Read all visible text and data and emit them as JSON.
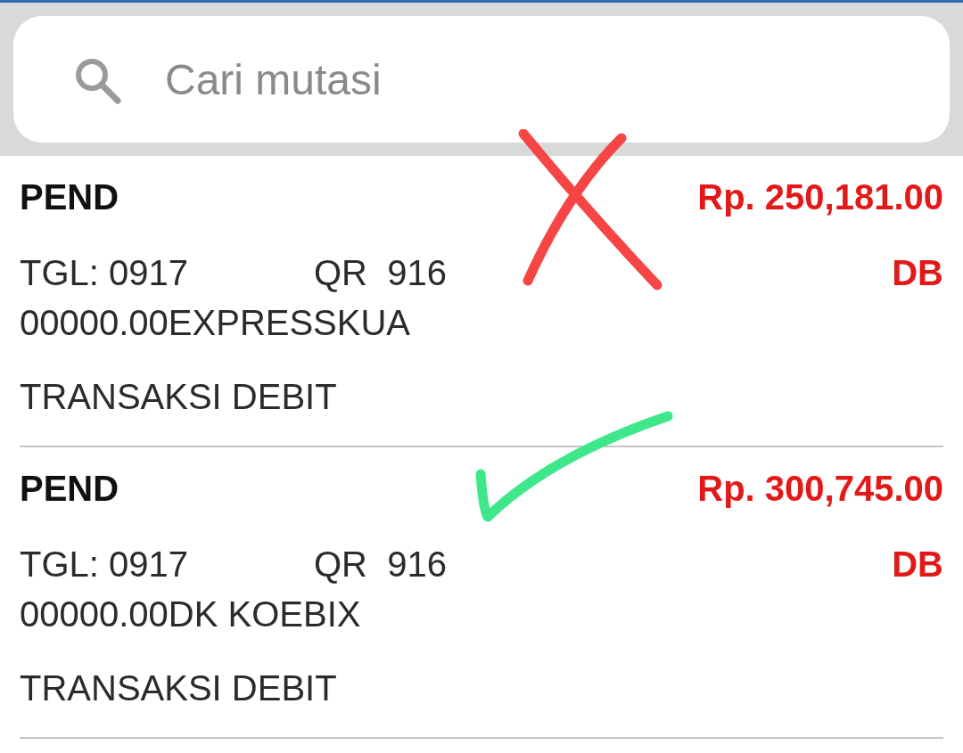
{
  "search": {
    "placeholder": "Cari mutasi"
  },
  "transactions": [
    {
      "status": "PEND",
      "amount": "Rp. 250,181.00",
      "date": "TGL: 0917",
      "ref": "QR  916",
      "type": "DB",
      "detail": "00000.00EXPRESSKUA",
      "description": "TRANSAKSI DEBIT",
      "annotation": {
        "kind": "cross",
        "color": "#f54545"
      }
    },
    {
      "status": "PEND",
      "amount": "Rp. 300,745.00",
      "date": "TGL: 0917",
      "ref": "QR  916",
      "type": "DB",
      "detail": "00000.00DK KOEBIX",
      "description": "TRANSAKSI DEBIT",
      "annotation": {
        "kind": "check",
        "color": "#3ee88a"
      }
    }
  ]
}
